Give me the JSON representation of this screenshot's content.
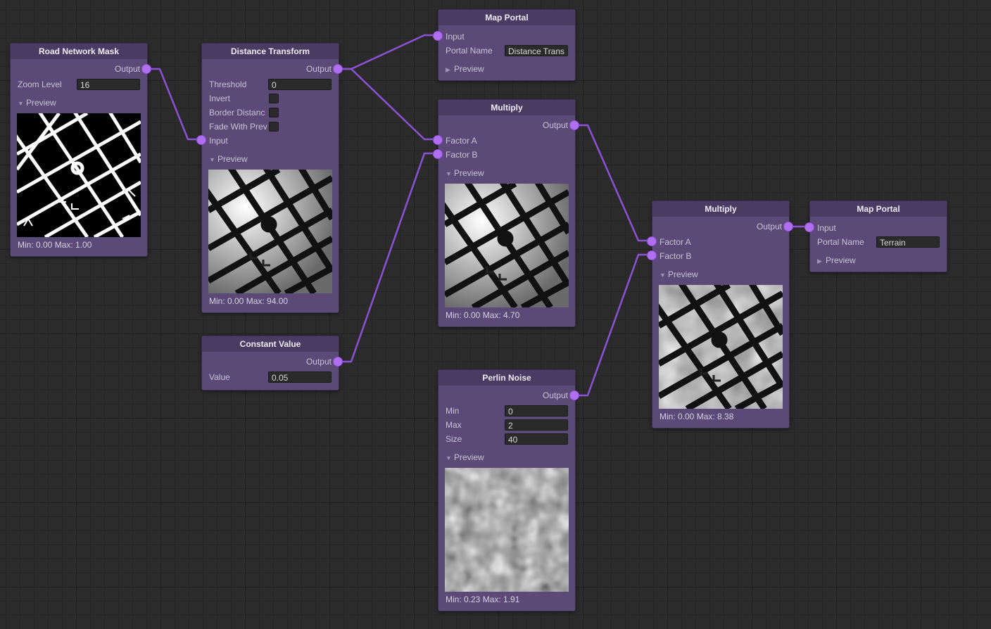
{
  "wire_color": "#8c52d6",
  "port_color": "#b06ef0",
  "node_color": "#5b4a78",
  "header_color": "#4a3b63",
  "nodes": {
    "road_mask": {
      "title": "Road Network Mask",
      "output": "Output",
      "zoom_label": "Zoom Level",
      "zoom_value": "16",
      "preview": "Preview",
      "stats": "Min: 0.00 Max: 1.00"
    },
    "distance": {
      "title": "Distance Transform",
      "output": "Output",
      "threshold_label": "Threshold",
      "threshold_value": "0",
      "invert_label": "Invert",
      "border_label": "Border Distanc",
      "fade_label": "Fade With Prev",
      "input": "Input",
      "preview": "Preview",
      "stats": "Min: 0.00 Max: 94.00"
    },
    "constant": {
      "title": "Constant Value",
      "output": "Output",
      "value_label": "Value",
      "value": "0.05"
    },
    "portal1": {
      "title": "Map Portal",
      "input": "Input",
      "name_label": "Portal Name",
      "name_value": "Distance Trans",
      "preview": "Preview"
    },
    "multiply1": {
      "title": "Multiply",
      "output": "Output",
      "factor_a": "Factor A",
      "factor_b": "Factor B",
      "preview": "Preview",
      "stats": "Min: 0.00 Max: 4.70"
    },
    "perlin": {
      "title": "Perlin Noise",
      "output": "Output",
      "min_label": "Min",
      "min_value": "0",
      "max_label": "Max",
      "max_value": "2",
      "size_label": "Size",
      "size_value": "40",
      "preview": "Preview",
      "stats": "Min: 0.23 Max: 1.91"
    },
    "multiply2": {
      "title": "Multiply",
      "output": "Output",
      "factor_a": "Factor A",
      "factor_b": "Factor B",
      "preview": "Preview",
      "stats": "Min: 0.00 Max: 8.38"
    },
    "portal2": {
      "title": "Map Portal",
      "input": "Input",
      "name_label": "Portal Name",
      "name_value": "Terrain",
      "preview": "Preview"
    }
  }
}
